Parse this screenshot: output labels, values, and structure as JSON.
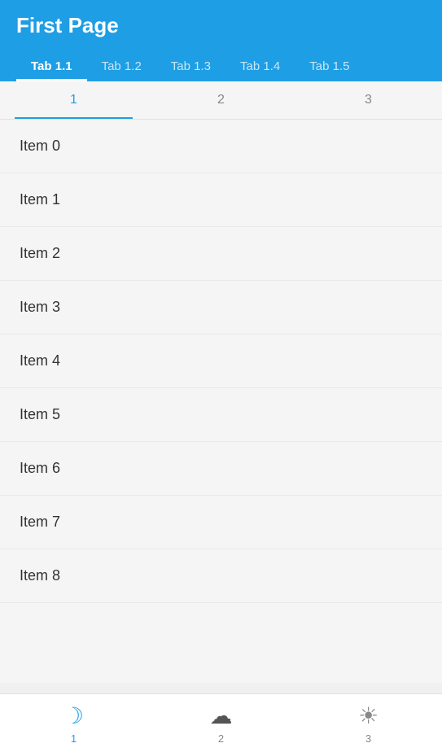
{
  "header": {
    "title": "First Page"
  },
  "tabs": [
    {
      "label": "Tab 1.1",
      "active": true
    },
    {
      "label": "Tab 1.2",
      "active": false
    },
    {
      "label": "Tab 1.3",
      "active": false
    },
    {
      "label": "Tab 1.4",
      "active": false
    },
    {
      "label": "Tab 1.5",
      "active": false
    }
  ],
  "subtabs": [
    {
      "label": "1",
      "active": true
    },
    {
      "label": "2",
      "active": false
    },
    {
      "label": "3",
      "active": false
    }
  ],
  "items": [
    "Item 0",
    "Item 1",
    "Item 2",
    "Item 3",
    "Item 4",
    "Item 5",
    "Item 6",
    "Item 7",
    "Item 8"
  ],
  "bottom_nav": [
    {
      "label": "1",
      "icon": "moon",
      "active": true
    },
    {
      "label": "2",
      "icon": "cloud",
      "active": false
    },
    {
      "label": "3",
      "icon": "sun",
      "active": false
    }
  ],
  "accent_color": "#1e9ee4"
}
